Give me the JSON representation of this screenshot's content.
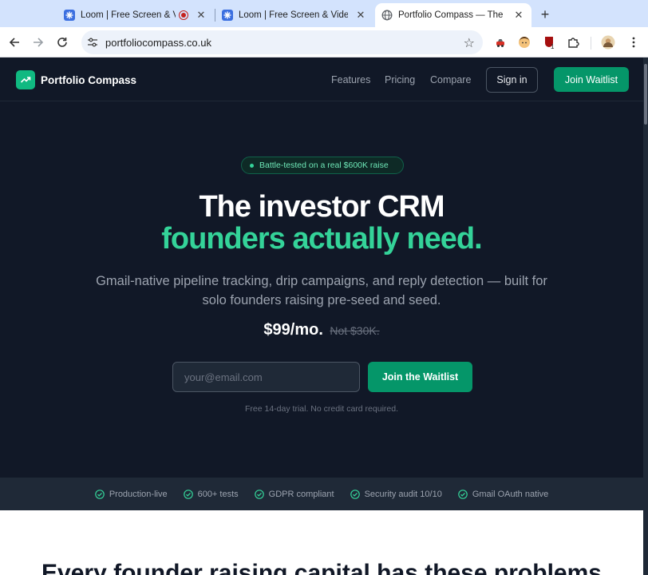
{
  "browser": {
    "tabs": [
      {
        "title": "Loom | Free Screen & Video Recording"
      },
      {
        "title": "Loom | Free Screen & Video Recording"
      },
      {
        "title": "Portfolio Compass — The investor CRM"
      }
    ],
    "url": "portfoliocompass.co.uk",
    "extension_badge": "1"
  },
  "site": {
    "brand": "Portfolio Compass",
    "nav": {
      "features": "Features",
      "pricing": "Pricing",
      "compare": "Compare",
      "sign_in": "Sign in",
      "join_waitlist": "Join Waitlist"
    },
    "hero": {
      "badge": "Battle-tested on a real $600K raise",
      "headline_1": "The investor CRM",
      "headline_2": "founders actually need.",
      "subtitle": "Gmail-native pipeline tracking, drip campaigns, and reply detection — built for solo founders raising pre-seed and seed.",
      "price": "$99/mo.",
      "old_price": "Not $30K.",
      "email_placeholder": "your@email.com",
      "cta": "Join the Waitlist",
      "note": "Free 14-day trial. No credit card required."
    },
    "trust": [
      "Production-live",
      "600+ tests",
      "GDPR compliant",
      "Security audit 10/10",
      "Gmail OAuth native"
    ],
    "problems_heading": "Every founder raising capital has these problems"
  },
  "colors": {
    "bg": "#111827",
    "accent": "#10b981",
    "headline_accent": "#34d399"
  }
}
